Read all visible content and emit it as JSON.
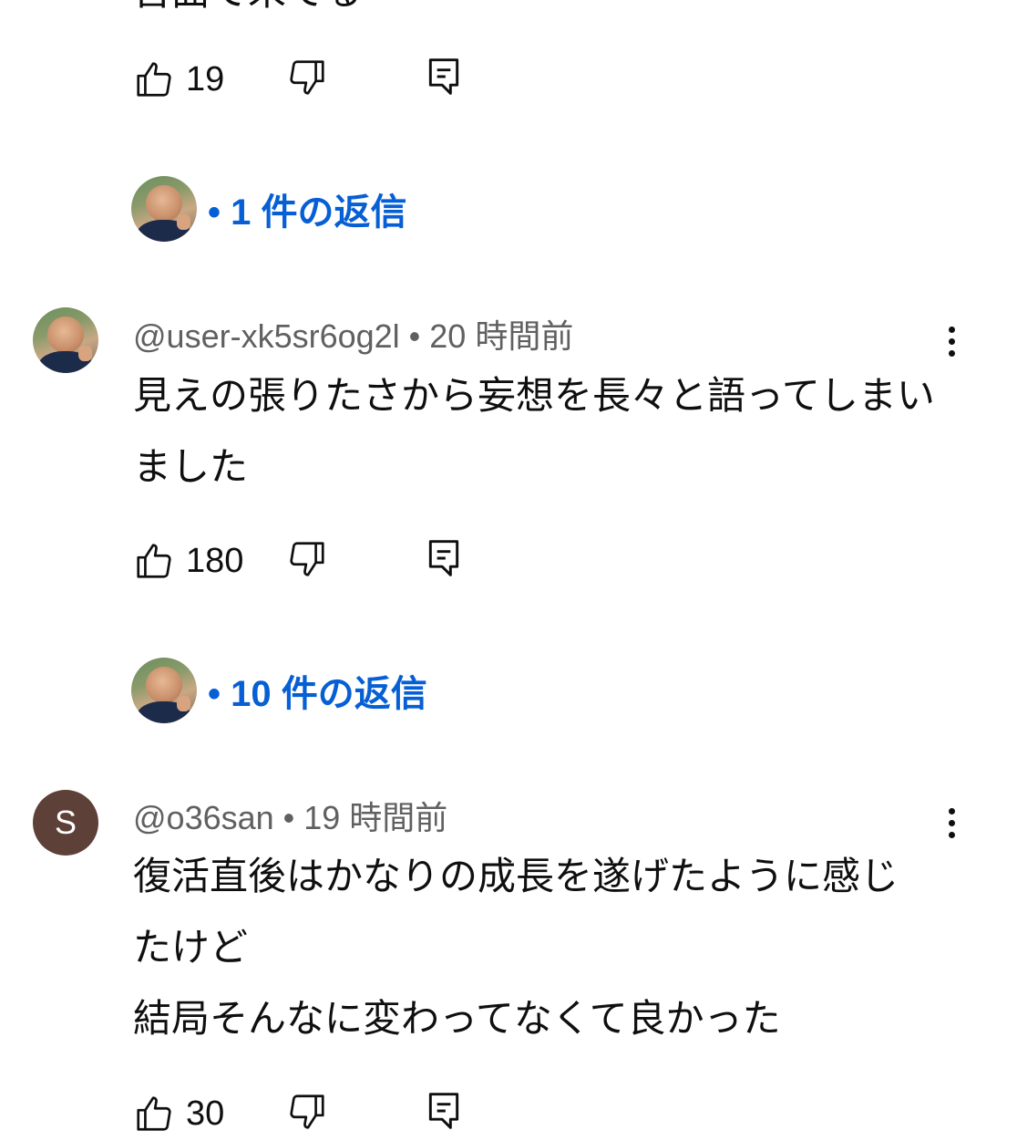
{
  "previous_comment": {
    "partial_text": "否曲で未てる",
    "like_count": "19"
  },
  "replies_1": {
    "label": "• 1 件の返信"
  },
  "comments": [
    {
      "author": "@user-xk5sr6og2l",
      "separator": " • ",
      "time": "20 時間前",
      "text": "見えの張りたさから妄想を長々と語ってしまいました",
      "like_count": "180",
      "replies_label": "• 10 件の返信"
    },
    {
      "author": "@o36san",
      "avatar_letter": "S",
      "avatar_color": "#5d4037",
      "separator": " • ",
      "time": "19 時間前",
      "text": "復活直後はかなりの成長を遂げたように感じたけど\n結局そんなに変わってなくて良かった",
      "like_count": "30"
    }
  ],
  "icons": {
    "like": "thumbs-up-icon",
    "dislike": "thumbs-down-icon",
    "reply": "comment-reply-icon",
    "menu": "more-vert-icon"
  },
  "colors": {
    "link_blue": "#065fd4",
    "meta_gray": "#606060",
    "text": "#0f0f0f"
  }
}
